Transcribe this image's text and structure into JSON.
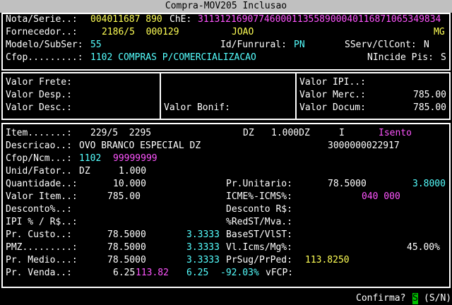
{
  "window": {
    "title": "Compra-MOV205  Inclusao"
  },
  "header": {
    "nota_label": "Nota/Serie..:",
    "nota_value": "004011687 890",
    "chave_label": "ChE:",
    "chave_value": "31131216907746000113558900040116871065349834",
    "fornecedor_label": "Fornecedor..:",
    "fornecedor_code": "2186/5  000129",
    "fornecedor_name": "JOAO",
    "fornecedor_uf": "MG",
    "modelo_label": "Modelo/SubSer:",
    "modelo_value": "55",
    "funrural_label": "Id/Funrural:",
    "funrural_value": "PN",
    "sserv_label": "SServ/ClCont:",
    "sserv_value": "N",
    "cfop_label": "Cfop.........:",
    "cfop_value": "1102 COMPRAS P/COMERCIALIZACAO",
    "nincide_label": "NIncide Pis:",
    "nincide_value": "S"
  },
  "totals": {
    "frete_label": "Valor Frete:",
    "desp_label": "Valor Desp.:",
    "desc_label": "Valor Desc.:",
    "bonif_label": "Valor Bonif:",
    "ipi_label": "Valor IPI..:",
    "merc_label": "Valor Merc.:",
    "merc_value": "785.00",
    "docum_label": "Valor Docum:",
    "docum_value": "785.00"
  },
  "item": {
    "item_label": "Item.......:",
    "item_value": "229/5  2295",
    "dz_label": "DZ",
    "qty_dz": "1.000DZ",
    "i_label": "I",
    "isento": "Isento",
    "descricao_label": "Descricao..:",
    "descricao_value": "OVO BRANCO ESPECIAL DZ",
    "ean": "3000000022917",
    "cfop_ncm_label": "Cfop/Ncm...:",
    "cfop_value": "1102",
    "ncm_value": "99999999",
    "unid_label": "Unid/Fator..",
    "unid_value": "DZ",
    "fator_value": "1.000",
    "quantidade_label": "Quantidade..:",
    "quantidade_value": "10.000",
    "prunit_label": "Pr.Unitario:",
    "prunit_value": "78.5000",
    "prunit_alt": "3.8000",
    "valoritem_label": "Valor Item..:",
    "valoritem_value": "785.00",
    "icms_label": "ICME%-ICMS%:",
    "icms_value": "040 000",
    "desconto_pct_label": "Desconto%..:",
    "desconto_rs_label": "Desconto R$:",
    "ipi_label": "IPI % / R$..:",
    "redst_label": "%RedST/Mva.:",
    "custo_label": "Pr. Custo..:",
    "custo_value": "78.5000",
    "custo_pct": "3.3333",
    "basest_label": "BaseST/VlST:",
    "pmz_label": "PMZ.........:",
    "pmz_value": "78.5000",
    "pmz_pct": "3.3333",
    "vlicms_label": "Vl.Icms/Mg%:",
    "vlicms_value": "45.00%",
    "medio_label": "Pr. Medio...:",
    "medio_value": "78.5000",
    "medio_pct": "3.3333",
    "prsug_label": "PrSug/PrPed:",
    "prsug_value": "113.8250",
    "venda_label": "Pr. Venda..:",
    "venda_value": "6.25",
    "venda_alt": "113.82",
    "venda_v3": "6.25",
    "venda_v4": "-92.03%",
    "vfcp_label": "vFCP:"
  },
  "status": {
    "confirma_label": "Confirma?",
    "confirma_value": "S",
    "confirma_options": "(S/N)"
  },
  "colors": {
    "yellow": "#ffff55",
    "magenta": "#ff55ff",
    "cyan": "#55ffff",
    "cursor": "#00c000"
  }
}
